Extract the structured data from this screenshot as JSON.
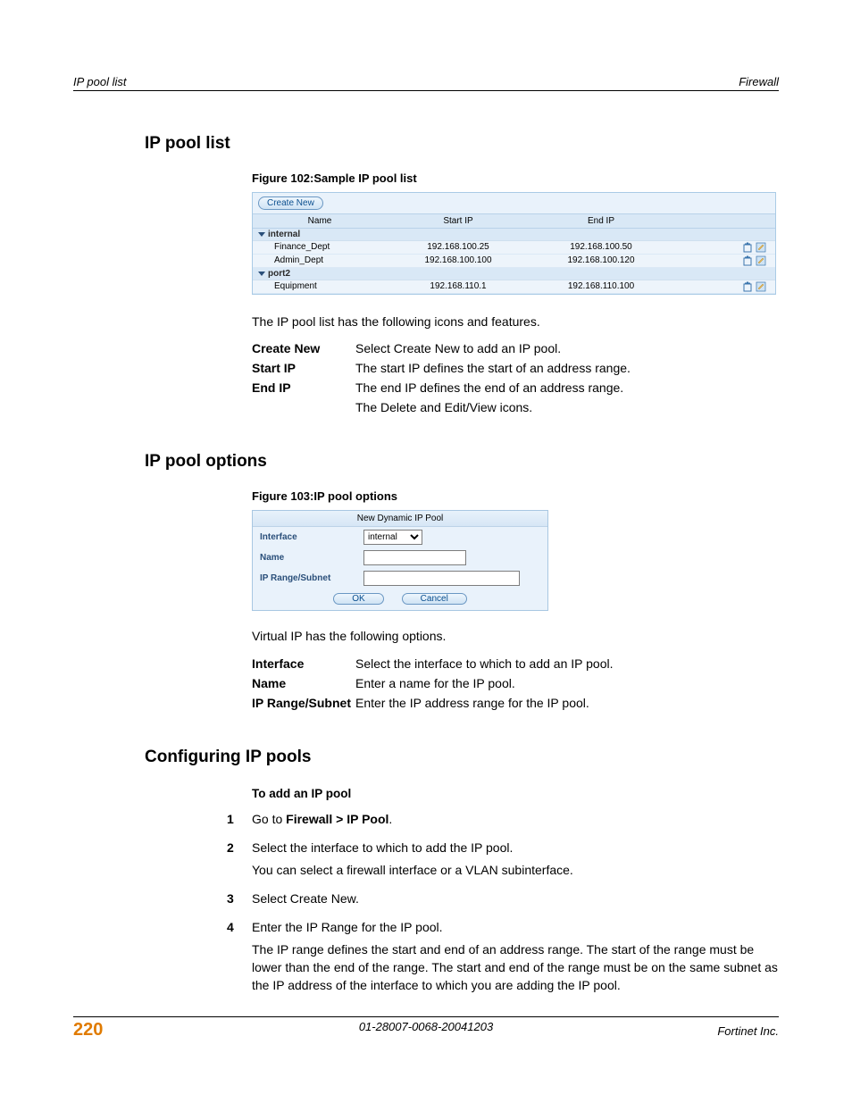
{
  "running_header": {
    "left": "IP pool list",
    "right": "Firewall"
  },
  "sections": {
    "list": {
      "title": "IP pool list",
      "figure_caption": "Figure 102:Sample IP pool list",
      "intro_para": "The IP pool list has the following icons and features.",
      "defs": [
        {
          "term": "Create New",
          "desc": "Select Create New to add an IP pool."
        },
        {
          "term": "Start IP",
          "desc": "The start IP defines the start of an address range."
        },
        {
          "term": "End IP",
          "desc": "The end IP defines the end of an address range."
        },
        {
          "term": "",
          "desc": "The Delete and Edit/View icons."
        }
      ]
    },
    "options": {
      "title": "IP pool options",
      "figure_caption": "Figure 103:IP pool options",
      "intro_para": "Virtual IP has the following options.",
      "defs": [
        {
          "term": "Interface",
          "desc": "Select the interface to which to add an IP pool."
        },
        {
          "term": "Name",
          "desc": "Enter a name for the IP pool."
        },
        {
          "term": "IP Range/Subnet",
          "desc": "Enter the IP address range for the IP pool."
        }
      ]
    },
    "configuring": {
      "title": "Configuring IP pools",
      "sub_head": "To add an IP pool",
      "steps": [
        {
          "n": "1",
          "lines": [
            "Go to <b>Firewall > IP Pool</b>."
          ]
        },
        {
          "n": "2",
          "lines": [
            "Select the interface to which to add the IP pool.",
            "You can select a firewall interface or a VLAN subinterface."
          ]
        },
        {
          "n": "3",
          "lines": [
            "Select Create New."
          ]
        },
        {
          "n": "4",
          "lines": [
            "Enter the IP Range for the IP pool.",
            "The IP range defines the start and end of an address range. The start of the range must be lower than the end of the range. The start and end of the range must be on the same subnet as the IP address of the interface to which you are adding the IP pool."
          ]
        }
      ]
    }
  },
  "pool_table": {
    "create_label": "Create New",
    "headers": {
      "name": "Name",
      "start": "Start IP",
      "end": "End IP"
    },
    "groups": [
      {
        "label": "internal",
        "rows": [
          {
            "name": "Finance_Dept",
            "start": "192.168.100.25",
            "end": "192.168.100.50"
          },
          {
            "name": "Admin_Dept",
            "start": "192.168.100.100",
            "end": "192.168.100.120"
          }
        ]
      },
      {
        "label": "port2",
        "rows": [
          {
            "name": "Equipment",
            "start": "192.168.110.1",
            "end": "192.168.110.100"
          }
        ]
      }
    ]
  },
  "dialog": {
    "title": "New Dynamic IP Pool",
    "fields": {
      "interface_label": "Interface",
      "interface_value": "internal",
      "name_label": "Name",
      "name_value": "",
      "range_label": "IP Range/Subnet",
      "range_value": ""
    },
    "buttons": {
      "ok": "OK",
      "cancel": "Cancel"
    }
  },
  "footer": {
    "page": "220",
    "center": "01-28007-0068-20041203",
    "right": "Fortinet Inc."
  }
}
